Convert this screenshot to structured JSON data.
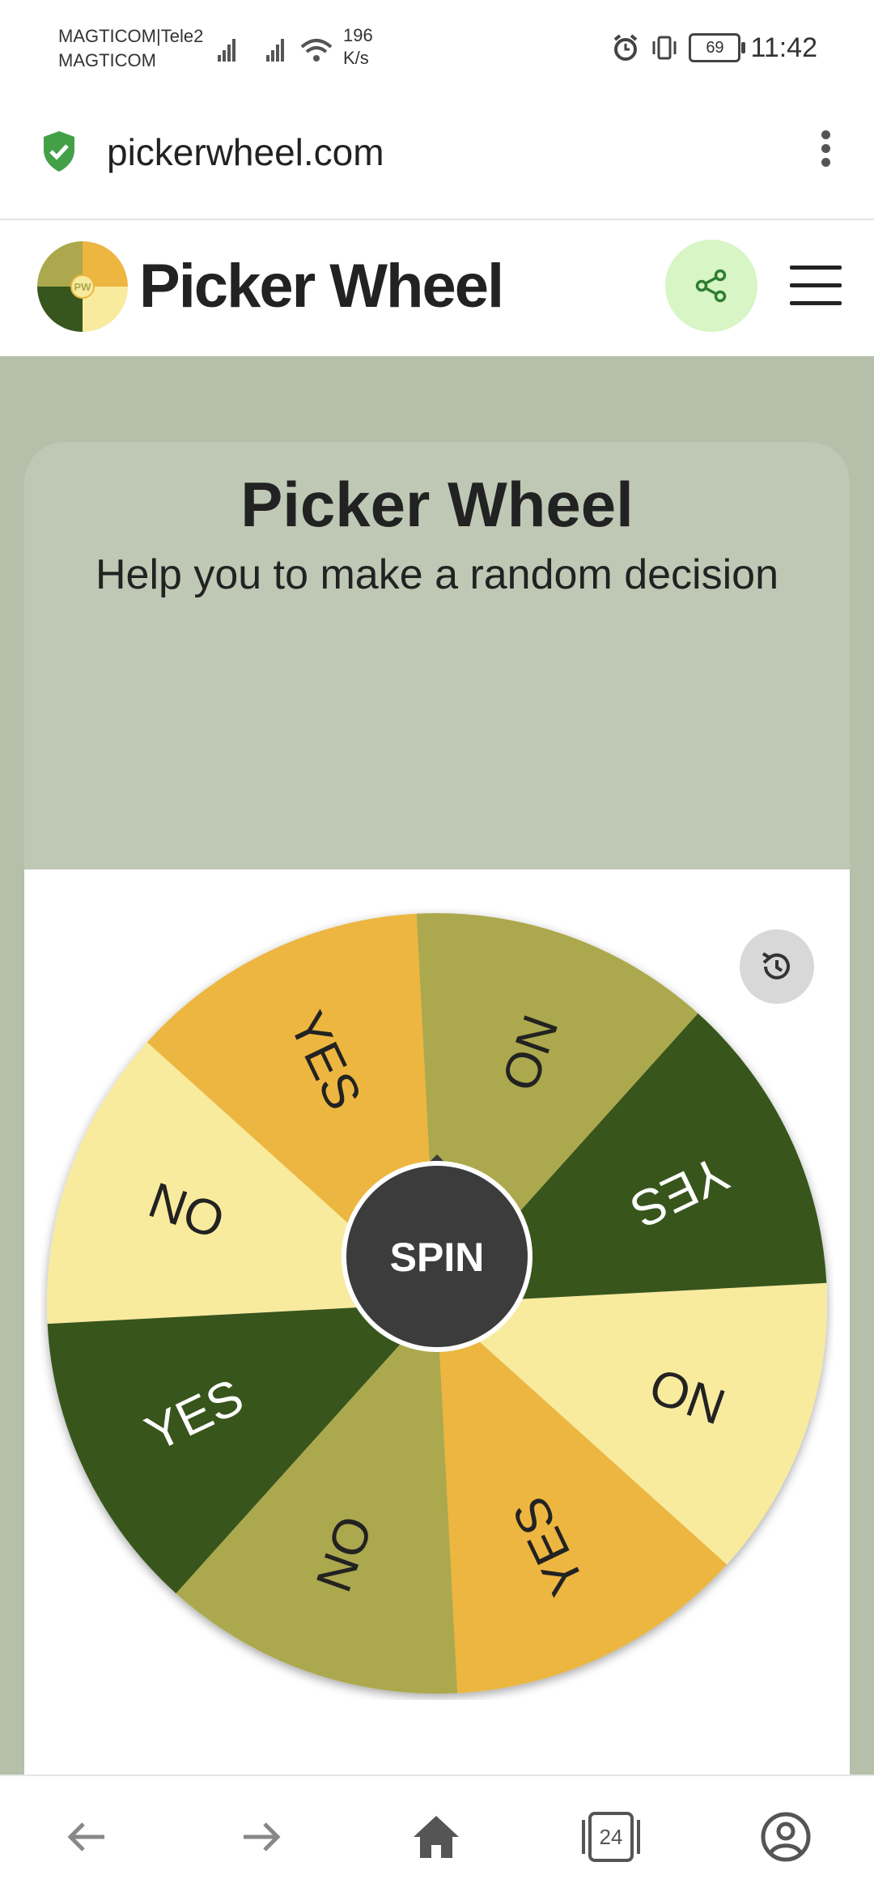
{
  "status_bar": {
    "carrier_line1": "MAGTICOM|Tele2",
    "carrier_line2": "MAGTICOM",
    "speed_value": "196",
    "speed_unit": "K/s",
    "battery": "69",
    "time": "11:42",
    "icons": [
      "signal-icon",
      "signal-icon",
      "wifi-icon",
      "alarm-icon",
      "vibrate-icon",
      "battery-icon"
    ]
  },
  "browser": {
    "url": "pickerwheel.com",
    "secure_icon": "shield-check-icon",
    "menu_icon": "more-vert-icon"
  },
  "site_header": {
    "logo_text": "PW",
    "brand": "Picker Wheel",
    "share_icon": "share-icon",
    "menu_icon": "hamburger-icon"
  },
  "hero": {
    "title": "Picker Wheel",
    "subtitle": "Help you to make a random decision"
  },
  "wheel": {
    "spin_label": "SPIN",
    "history_icon": "history-icon",
    "segments": [
      {
        "label": "YES",
        "color": "#ecb641"
      },
      {
        "label": "NO",
        "color": "#f8eb9e"
      },
      {
        "label": "YES",
        "color": "#37551e"
      },
      {
        "label": "NO",
        "color": "#aca84d"
      },
      {
        "label": "YES",
        "color": "#ecb641"
      },
      {
        "label": "NO",
        "color": "#f8eb9e"
      },
      {
        "label": "YES",
        "color": "#37551e"
      },
      {
        "label": "NO",
        "color": "#aca84d"
      }
    ]
  },
  "bottom_nav": {
    "tab_count": "24",
    "items": [
      "back-arrow-icon",
      "forward-arrow-icon",
      "home-icon",
      "tabs-icon",
      "account-icon"
    ]
  },
  "colors": {
    "page_bg": "#b5bfa9",
    "hero_bg": "#bfc8b4",
    "spin_bg": "#3c3c3c",
    "share_bg": "#d7f5c5",
    "accent_green": "#37551e"
  }
}
